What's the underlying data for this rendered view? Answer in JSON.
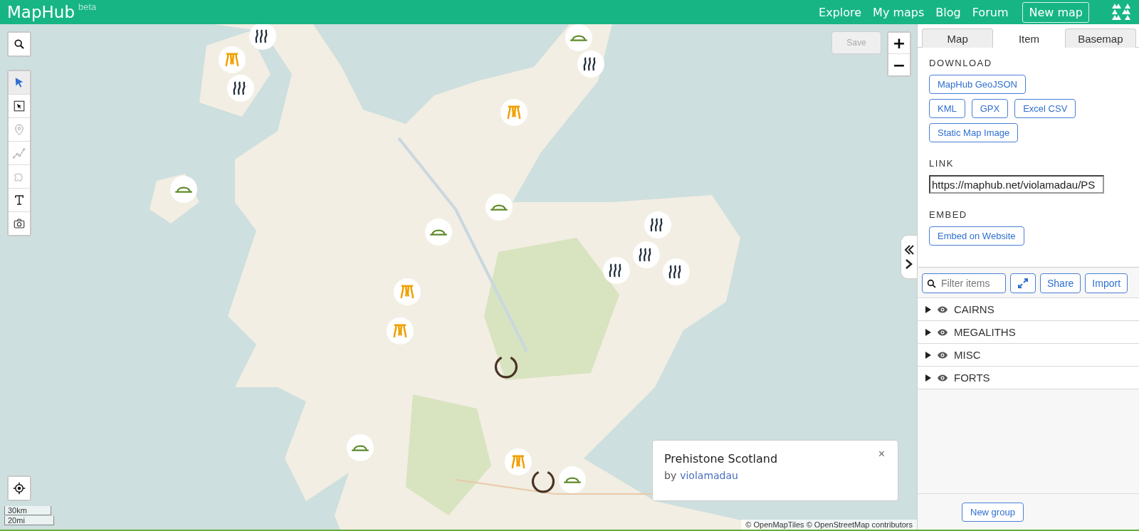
{
  "header": {
    "logo": "MapHub",
    "badge": "beta",
    "nav": [
      "Explore",
      "My maps",
      "Blog",
      "Forum"
    ],
    "new_map": "New map"
  },
  "map": {
    "save": "Save",
    "zoom_in": "+",
    "zoom_out": "−",
    "tools": [
      {
        "kind": "pointer",
        "selected": true
      },
      {
        "kind": "select",
        "selected": false
      },
      {
        "kind": "marker",
        "selected": false
      },
      {
        "kind": "line",
        "selected": false
      },
      {
        "kind": "polygon",
        "selected": false
      },
      {
        "kind": "text",
        "selected": false
      },
      {
        "kind": "camera",
        "selected": false
      }
    ],
    "popup": {
      "title": "Prehistone Scotland",
      "by": "by",
      "author": "violamadau",
      "close": "×"
    },
    "scale": [
      "30km",
      "20mi"
    ],
    "attribution": "© OpenMapTiles © OpenStreetMap contributors"
  },
  "panel": {
    "tabs": [
      {
        "label": "Map",
        "selected": false
      },
      {
        "label": "Item",
        "selected": true
      },
      {
        "label": "Basemap",
        "selected": false
      }
    ],
    "download": {
      "heading": "DOWNLOAD",
      "buttons": [
        "MapHub GeoJSON",
        "KML",
        "GPX",
        "Excel CSV",
        "Static Map Image"
      ]
    },
    "link": {
      "heading": "LINK",
      "value": "https://maphub.net/violamadau/PS"
    },
    "embed": {
      "heading": "EMBED",
      "button": "Embed on Website"
    },
    "filter": {
      "placeholder": "Filter items"
    },
    "share": "Share",
    "import": "Import",
    "groups": [
      {
        "label": "CAIRNS",
        "expanded": false,
        "visible": true
      },
      {
        "label": "MEGALITHS",
        "expanded": false,
        "visible": true
      },
      {
        "label": "MISC",
        "expanded": false,
        "visible": true
      },
      {
        "label": "FORTS",
        "expanded": false,
        "visible": true
      }
    ],
    "new_group": "New group"
  }
}
